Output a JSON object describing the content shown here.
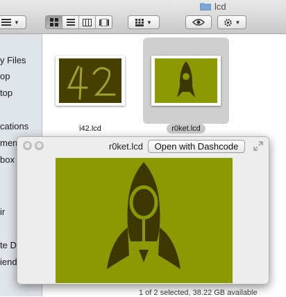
{
  "window": {
    "title": "lcd"
  },
  "toolbar": {
    "icons": [
      "list-view-menu-icon",
      "icon-view-icon",
      "list-view-icon",
      "column-view-icon",
      "cover-flow-icon",
      "arrange-icon",
      "quick-look-eye-icon",
      "action-gear-icon"
    ]
  },
  "sidebar": {
    "items": [
      {
        "label": "y Files"
      },
      {
        "label": "op"
      },
      {
        "label": "top"
      },
      {
        "label": "cations"
      },
      {
        "label": "men"
      },
      {
        "label": "box"
      },
      {
        "label": "ir"
      },
      {
        "label": "te Disc"
      },
      {
        "label": "iends"
      }
    ]
  },
  "files": [
    {
      "name": "i42.lcd",
      "preview_text": "42"
    },
    {
      "name": "r0ket.lcd",
      "selected": true
    }
  ],
  "status": {
    "text": "1 of 2 selected, 38.22 GB available"
  },
  "quicklook": {
    "filename": "r0ket.lcd",
    "open_button": "Open with Dashcode",
    "close_glyph": "⊗",
    "fullscreen_glyph": "⊕"
  },
  "colors": {
    "lcd_background": "#8a9a00",
    "lcd_pixel": "#3d3800",
    "selection": "#cfcfcf"
  }
}
